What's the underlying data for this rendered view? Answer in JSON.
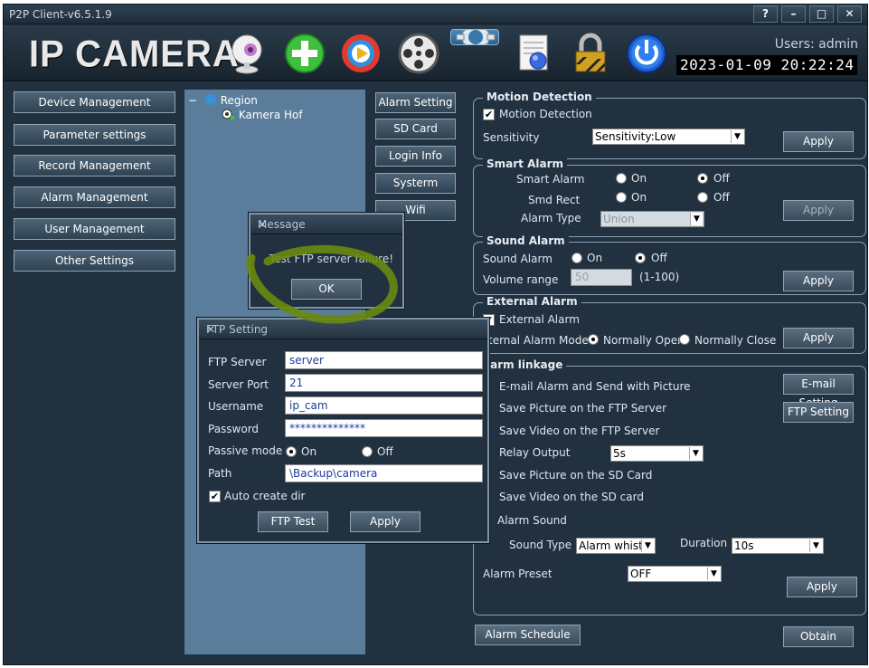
{
  "window": {
    "title": "P2P Client-v6.5.1.9",
    "help": "?",
    "minimize": "–",
    "maximize": "□",
    "close": "✕"
  },
  "header": {
    "logo": "IP CAMERA",
    "users": "Users: admin",
    "datetime": "2023-01-09 20:22:24",
    "toolbar": [
      "webcam-icon",
      "add-device-icon",
      "playback-icon",
      "reel-icon",
      "settings-gear-icon",
      "log-report-icon",
      "lock-icon",
      "power-icon"
    ]
  },
  "nav": [
    "Device Management",
    "Parameter settings",
    "Record Management",
    "Alarm Management",
    "User Management",
    "Other Settings"
  ],
  "tree": {
    "root": "Region",
    "child": "Kamera Hof",
    "expander": "−"
  },
  "tabs": [
    "Alarm Setting",
    "SD Card",
    "Login Info",
    "Systerm",
    "Wifi"
  ],
  "motion": {
    "title": "Motion Detection",
    "enable_label": "Motion Detection",
    "sensitivity_label": "Sensitivity",
    "sensitivity_value": "Sensitivity:Low",
    "apply": "Apply"
  },
  "smart": {
    "title": "Smart Alarm",
    "smart_label": "Smart Alarm",
    "rect_label": "Smd Rect",
    "on": "On",
    "off": "Off",
    "type_label": "Alarm Type",
    "type_value": "Union",
    "apply": "Apply"
  },
  "sound": {
    "title": "Sound Alarm",
    "label": "Sound Alarm",
    "on": "On",
    "off": "Off",
    "volume_label": "Volume range",
    "volume_value": "50",
    "volume_hint": "(1-100)",
    "apply": "Apply"
  },
  "external": {
    "title": "External Alarm",
    "enable_label": "External Alarm",
    "mode_label": "ternal Alarm Mode",
    "open": "Normally Open",
    "close": "Normally Close",
    "apply": "Apply"
  },
  "linkage": {
    "title": "larm linkage",
    "items": [
      "E-mail Alarm and Send with Picture",
      "Save Picture on the FTP Server",
      "Save Video on the FTP Server",
      "Relay Output",
      "Save Picture on the SD Card",
      "Save Video on the SD card",
      "Alarm Sound"
    ],
    "email_btn": "E-mail Setting",
    "ftp_btn": "FTP Setting",
    "relay_value": "5s",
    "sound_type_label": "Sound Type",
    "sound_type_value": "Alarm whistle",
    "duration_label": "Duration",
    "duration_value": "10s",
    "preset_label": "Alarm Preset",
    "preset_value": "OFF",
    "apply": "Apply"
  },
  "bottom": {
    "schedule": "Alarm Schedule",
    "obtain": "Obtain"
  },
  "message": {
    "title": "Message",
    "text": "Test FTP server failure!",
    "ok": "OK",
    "close": "✕"
  },
  "ftp": {
    "title": "FTP Setting",
    "close": "✕",
    "server_label": "FTP Server",
    "server_value": "server",
    "port_label": "Server Port",
    "port_value": "21",
    "user_label": "Username",
    "user_value": "ip_cam",
    "pass_label": "Password",
    "pass_value": "**************",
    "passive_label": "Passive mode",
    "on": "On",
    "off": "Off",
    "path_label": "Path",
    "path_value": "\\Backup\\camera",
    "autocreate_label": "Auto create dir",
    "test": "FTP Test",
    "apply": "Apply"
  }
}
